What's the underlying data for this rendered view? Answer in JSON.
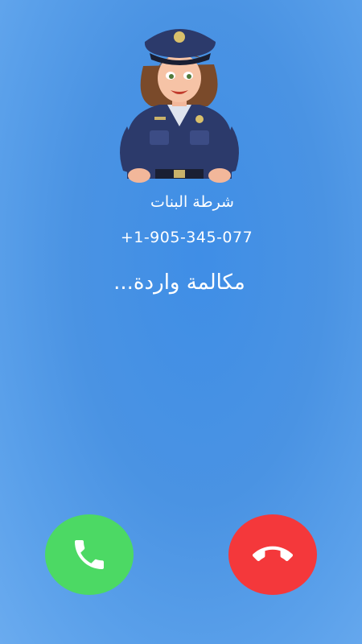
{
  "caller": {
    "name": "شرطة البنات",
    "number": "+1-905-345-077",
    "status": "مكالمة واردة...",
    "avatar": "policewoman-avatar"
  },
  "actions": {
    "accept": {
      "icon": "phone-icon",
      "color": "#4cd964"
    },
    "decline": {
      "icon": "phone-hangup-icon",
      "color": "#f4383b"
    }
  },
  "colors": {
    "background": "#4a93e3",
    "text": "#ffffff"
  }
}
